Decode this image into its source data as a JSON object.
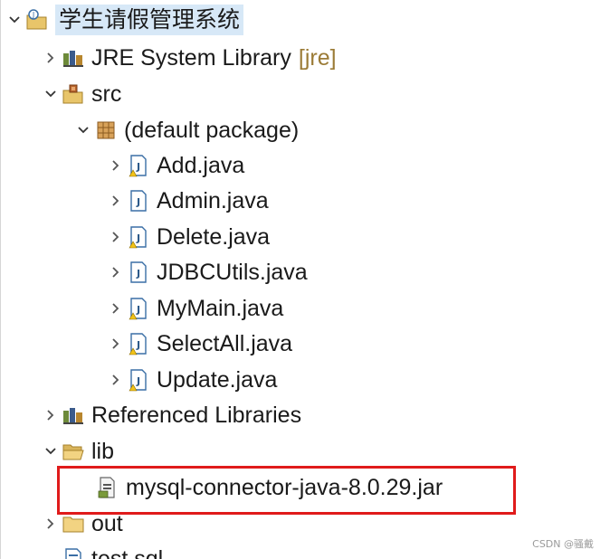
{
  "tree": {
    "project": {
      "label": "学生请假管理系统",
      "toggle_icon": "chevron-down-icon",
      "icon": "java-project-icon"
    },
    "jre": {
      "label": "JRE System Library",
      "suffix": "[jre]",
      "toggle_icon": "chevron-right-icon",
      "icon": "library-icon"
    },
    "src": {
      "label": "src",
      "toggle_icon": "chevron-down-icon",
      "icon": "source-folder-icon"
    },
    "default_package": {
      "label": "(default package)",
      "toggle_icon": "chevron-down-icon",
      "icon": "package-icon"
    },
    "files": [
      {
        "label": "Add.java",
        "icon": "java-file-warning-icon"
      },
      {
        "label": "Admin.java",
        "icon": "java-file-icon"
      },
      {
        "label": "Delete.java",
        "icon": "java-file-warning-icon"
      },
      {
        "label": "JDBCUtils.java",
        "icon": "java-file-icon"
      },
      {
        "label": "MyMain.java",
        "icon": "java-file-warning-icon"
      },
      {
        "label": "SelectAll.java",
        "icon": "java-file-warning-icon"
      },
      {
        "label": "Update.java",
        "icon": "java-file-warning-icon"
      }
    ],
    "referenced_libraries": {
      "label": "Referenced Libraries",
      "toggle_icon": "chevron-right-icon",
      "icon": "library-icon"
    },
    "lib": {
      "label": "lib",
      "toggle_icon": "chevron-down-icon",
      "icon": "folder-open-icon"
    },
    "jar": {
      "label": "mysql-connector-java-8.0.29.jar",
      "icon": "jar-file-icon"
    },
    "out": {
      "label": "out",
      "toggle_icon": "chevron-right-icon",
      "icon": "folder-icon"
    },
    "sql": {
      "label": "test.sql",
      "icon": "sql-file-icon"
    }
  },
  "watermark": "CSDN @骚戴",
  "colors": {
    "selection": "#d7e8f7",
    "highlight_border": "#e01b1b",
    "suffix": "#9b7b36"
  }
}
